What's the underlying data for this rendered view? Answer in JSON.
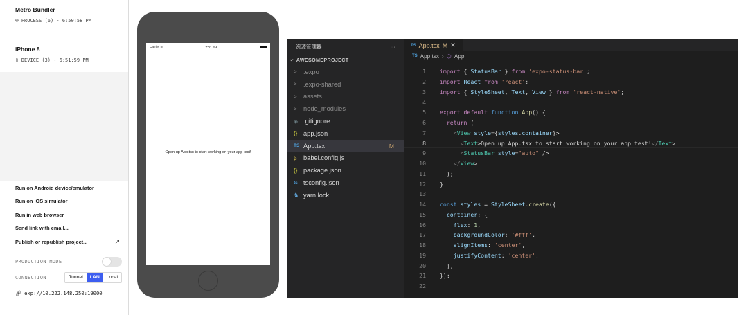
{
  "expo": {
    "metro": {
      "title": "Metro Bundler",
      "icon": "process-icon",
      "status": "PROCESS (6) - 6:50:58 PM"
    },
    "device": {
      "title": "iPhone 8",
      "icon": "device-icon",
      "status": "DEVICE (3) - 6:51:59 PM"
    },
    "actions": [
      "Run on Android device/emulator",
      "Run on iOS simulator",
      "Run in web browser",
      "Send link with email...",
      "Publish or republish project..."
    ],
    "production_mode_label": "PRODUCTION MODE",
    "connection_label": "CONNECTION",
    "connection_options": [
      "Tunnel",
      "LAN",
      "Local"
    ],
    "connection_selected": "LAN",
    "url": "exp://10.222.148.250:19000",
    "accent_color": "#3d5ef0"
  },
  "simulator": {
    "carrier": "Carrier",
    "time": "7:01 PM",
    "app_text": "Open up App.tsx to start working on your app test!"
  },
  "vscode": {
    "explorer_title": "资源管理器",
    "explorer_menu": "···",
    "project": "AWESOMEPROJECT",
    "files": [
      {
        "name": ".expo",
        "icon": "chevron-right-icon",
        "glyph": ">"
      },
      {
        "name": ".expo-shared",
        "icon": "chevron-right-icon",
        "glyph": ">"
      },
      {
        "name": "assets",
        "icon": "chevron-right-icon",
        "glyph": ">"
      },
      {
        "name": "node_modules",
        "icon": "chevron-right-icon",
        "glyph": ">"
      },
      {
        "name": ".gitignore",
        "icon": "gitignore-icon",
        "glyph": "◈"
      },
      {
        "name": "app.json",
        "icon": "json-icon",
        "glyph": "{}"
      },
      {
        "name": "App.tsx",
        "icon": "typescript-icon",
        "glyph": "TS",
        "badge": "M"
      },
      {
        "name": "babel.config.js",
        "icon": "babel-icon",
        "glyph": "β"
      },
      {
        "name": "package.json",
        "icon": "json-icon",
        "glyph": "{}"
      },
      {
        "name": "tsconfig.json",
        "icon": "tsconfig-icon",
        "glyph": "ts"
      },
      {
        "name": "yarn.lock",
        "icon": "yarn-icon",
        "glyph": "♞"
      }
    ],
    "tab": {
      "badge": "TS",
      "name": "App.tsx",
      "modified": "M"
    },
    "breadcrumb": {
      "file": "App.tsx",
      "symbol": "App"
    },
    "current_line": 8,
    "code_lines": [
      "import { StatusBar } from 'expo-status-bar';",
      "import React from 'react';",
      "import { StyleSheet, Text, View } from 'react-native';",
      "",
      "export default function App() {",
      "  return (",
      "    <View style={styles.container}>",
      "      <Text>Open up App.tsx to start working on your app test!</Text>",
      "      <StatusBar style=\"auto\" />",
      "    </View>",
      "  );",
      "}",
      "",
      "const styles = StyleSheet.create({",
      "  container: {",
      "    flex: 1,",
      "    backgroundColor: '#fff',",
      "    alignItems: 'center',",
      "    justifyContent: 'center',",
      "  },",
      "});",
      ""
    ]
  }
}
